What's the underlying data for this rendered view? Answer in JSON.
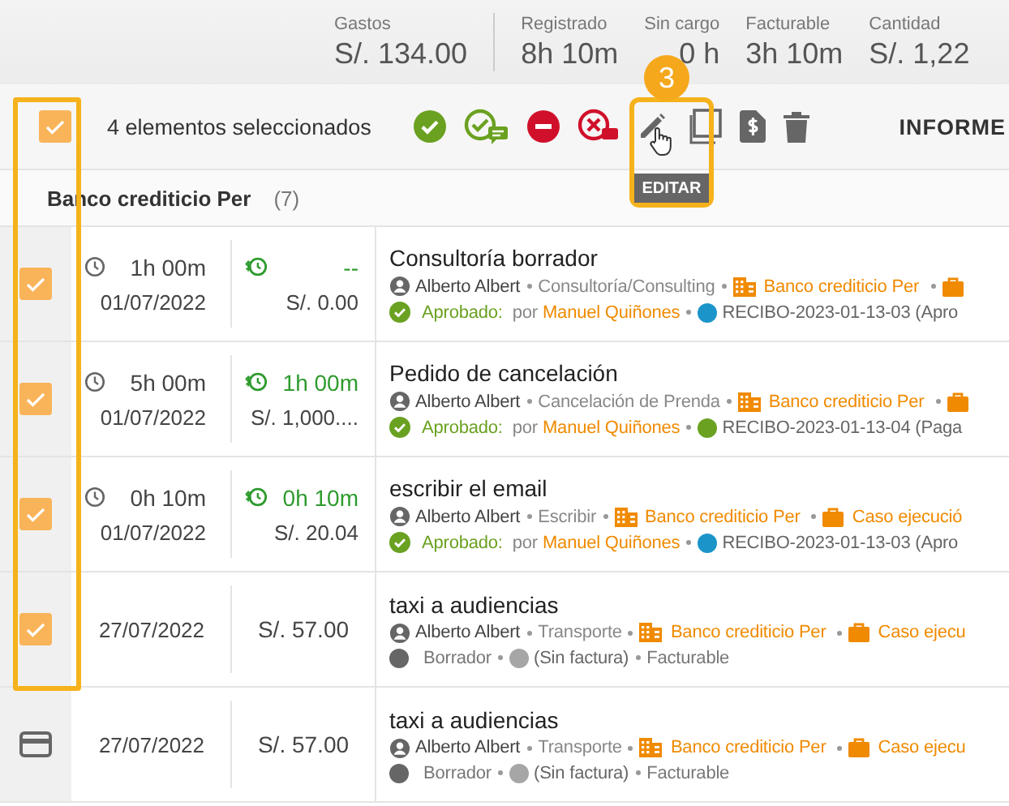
{
  "summary": [
    {
      "label": "Gastos",
      "value": "S/. 134.00"
    },
    {
      "label": "Registrado",
      "value": "8h 10m"
    },
    {
      "label": "Sin cargo",
      "value": "0 h"
    },
    {
      "label": "Facturable",
      "value": "3h 10m"
    },
    {
      "label": "Cantidad",
      "value": "S/. 1,22"
    }
  ],
  "toolbar": {
    "select_all_checked": true,
    "selection_text": "4 elementos seleccionados",
    "report_button": "INFORME"
  },
  "callout": {
    "badge": "3",
    "tooltip": "EDITAR"
  },
  "group": {
    "name": "Banco crediticio Per",
    "count": "(7)"
  },
  "rows": [
    {
      "kind": "time",
      "checked": true,
      "duration": "1h 00m",
      "date": "01/07/2022",
      "billable": "--",
      "amount": "S/. 0.00",
      "title": "Consultoría borrador",
      "user": "Alberto Albert",
      "category": "Consultoría/Consulting",
      "client": "Banco crediticio Per",
      "status": {
        "kind": "approved",
        "label": "Aprobado:",
        "by": "por",
        "approver": "Manuel Quiñones"
      },
      "invoice": {
        "color": "#1b95c9",
        "label": "RECIBO-2023-01-13-03 (Apro"
      }
    },
    {
      "kind": "time",
      "checked": true,
      "duration": "5h 00m",
      "date": "01/07/2022",
      "billable": "1h 00m",
      "amount": "S/. 1,000....",
      "title": "Pedido de cancelación",
      "user": "Alberto Albert",
      "category": "Cancelación de Prenda",
      "client": "Banco crediticio Per",
      "status": {
        "kind": "approved",
        "label": "Aprobado:",
        "by": "por",
        "approver": "Manuel Quiñones"
      },
      "invoice": {
        "color": "#6aa121",
        "label": "RECIBO-2023-01-13-04 (Paga"
      }
    },
    {
      "kind": "time",
      "checked": true,
      "duration": "0h 10m",
      "date": "01/07/2022",
      "billable": "0h 10m",
      "amount": "S/. 20.04",
      "title": "escribir el email",
      "user": "Alberto Albert",
      "category": "Escribir",
      "client": "Banco crediticio Per",
      "matter": "Caso ejecució",
      "status": {
        "kind": "approved",
        "label": "Aprobado:",
        "by": "por",
        "approver": "Manuel Quiñones"
      },
      "invoice": {
        "color": "#1b95c9",
        "label": "RECIBO-2023-01-13-03 (Apro"
      }
    },
    {
      "kind": "expense",
      "checked": true,
      "date": "27/07/2022",
      "amount": "S/. 57.00",
      "title": "taxi a audiencias",
      "user": "Alberto Albert",
      "category": "Transporte",
      "client": "Banco crediticio Per",
      "matter": "Caso ejecu",
      "status": {
        "kind": "draft",
        "label": "Borrador"
      },
      "invoice": {
        "color": "#a6a6a6",
        "label": "(Sin factura)"
      },
      "billing": "Facturable"
    },
    {
      "kind": "expense",
      "checked": false,
      "date": "27/07/2022",
      "amount": "S/. 57.00",
      "title": "taxi a audiencias",
      "user": "Alberto Albert",
      "category": "Transporte",
      "client": "Banco crediticio Per",
      "matter": "Caso ejecu",
      "status": {
        "kind": "draft",
        "label": "Borrador"
      },
      "invoice": {
        "color": "#a6a6a6",
        "label": "(Sin factura)"
      },
      "billing": "Facturable"
    }
  ]
}
